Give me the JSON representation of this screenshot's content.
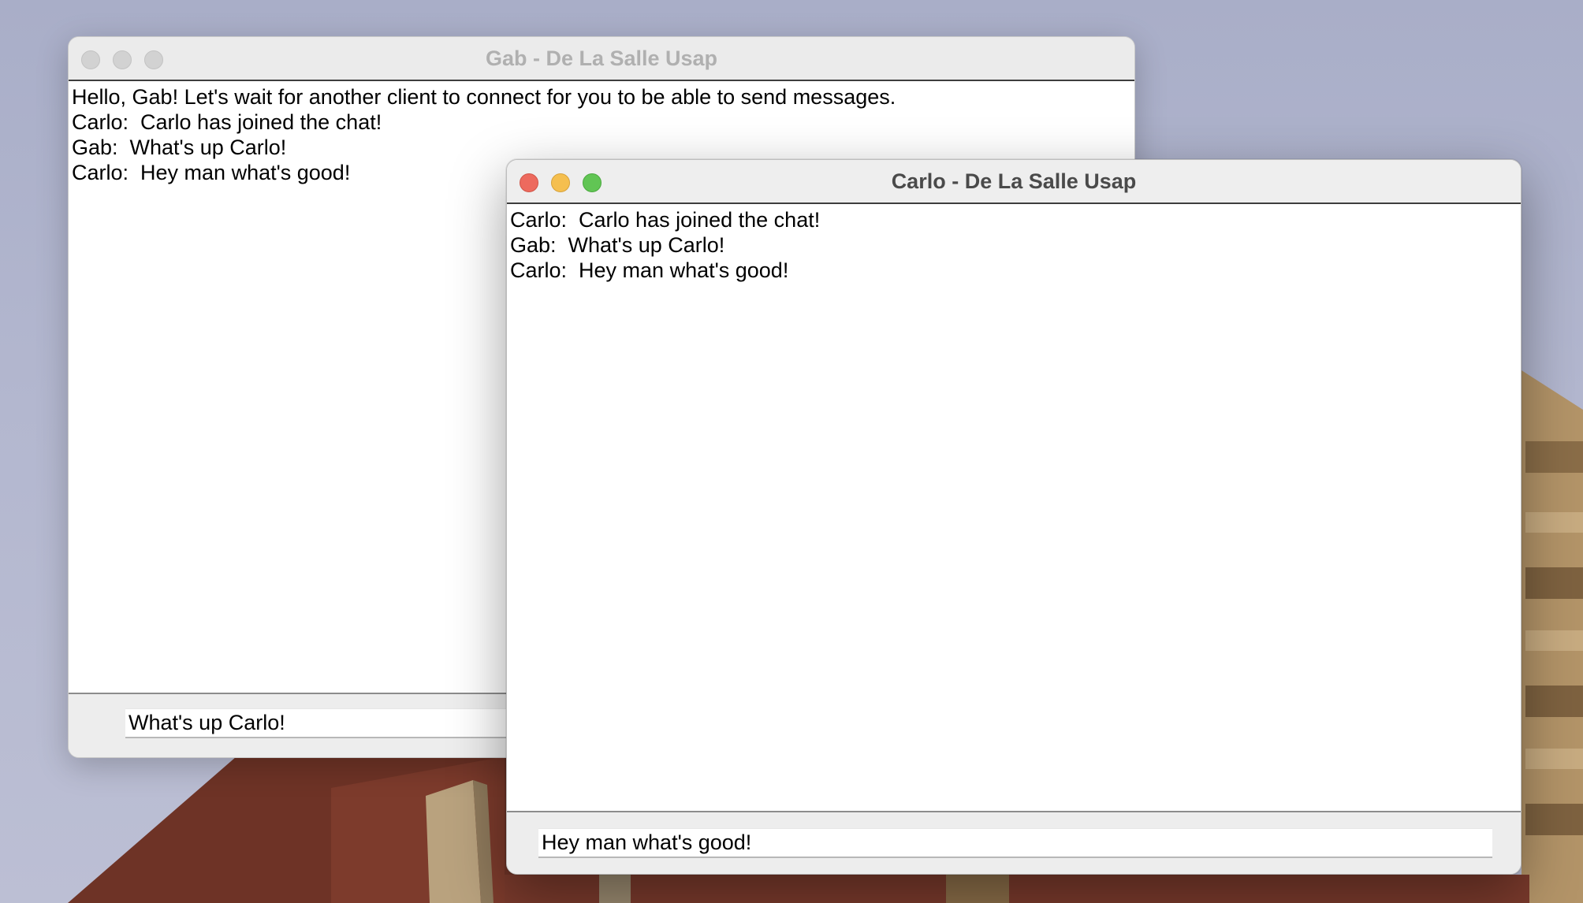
{
  "desktop": {
    "colors": {
      "sky": "#b3b7cf",
      "brick": "#7a3a2c",
      "stone": "#b79a72"
    }
  },
  "windows": [
    {
      "id": "gab",
      "title": "Gab - De La Salle Usap",
      "active": false,
      "messages": [
        "Hello, Gab! Let's wait for another client to connect for you to be able to send messages.",
        "Carlo:  Carlo has joined the chat!",
        "Gab:  What's up Carlo!",
        "Carlo:  Hey man what's good!"
      ],
      "input_value": "What's up Carlo!"
    },
    {
      "id": "carlo",
      "title": "Carlo - De La Salle Usap",
      "active": true,
      "messages": [
        "Carlo:  Carlo has joined the chat!",
        "Gab:  What's up Carlo!",
        "Carlo:  Hey man what's good!"
      ],
      "input_value": "Hey man what's good!"
    }
  ],
  "colors": {
    "traffic_close": "#ed6a5e",
    "traffic_minimize": "#f5bf4f",
    "traffic_zoom": "#61c554",
    "traffic_inactive": "#d2d2d2"
  }
}
